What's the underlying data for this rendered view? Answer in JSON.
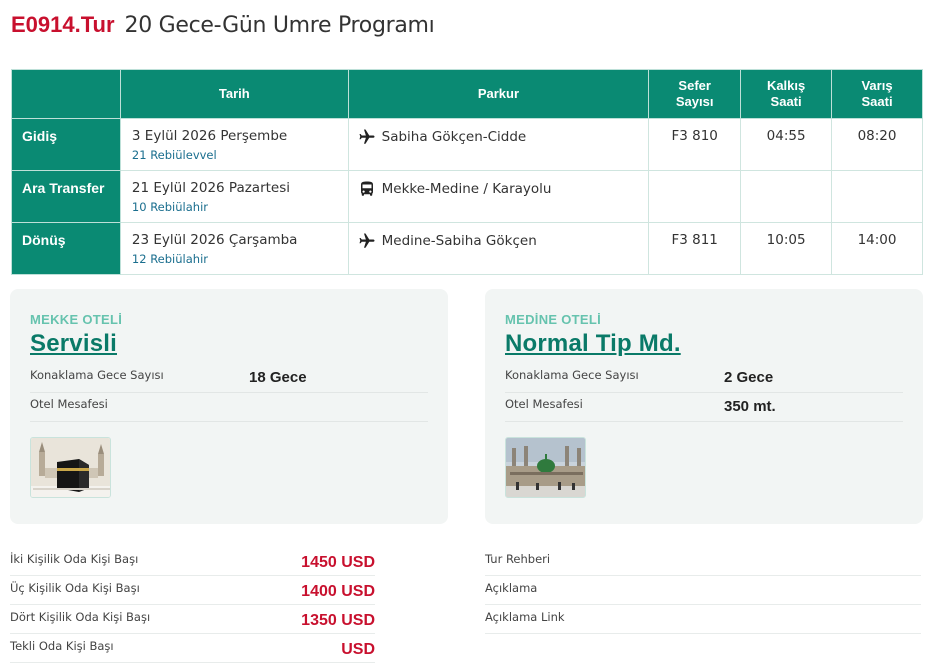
{
  "tour": {
    "code": "E0914.Tur",
    "name": "20 Gece-Gün Umre Programı"
  },
  "itinerary": {
    "headers": {
      "date": "Tarih",
      "route": "Parkur",
      "flight_l1": "Sefer",
      "flight_l2": "Sayısı",
      "dep_l1": "Kalkış",
      "dep_l2": "Saati",
      "arr_l1": "Varış",
      "arr_l2": "Saati"
    },
    "rows": [
      {
        "label": "Gidiş",
        "date": "3 Eylül 2026 Perşembe",
        "hijri": "21 Rebiülevvel",
        "route_icon": "plane-icon",
        "route": "Sabiha Gökçen-Cidde",
        "flight": "F3 810",
        "departure": "04:55",
        "arrival": "08:20"
      },
      {
        "label": "Ara Transfer",
        "date": "21 Eylül 2026 Pazartesi",
        "hijri": "10 Rebiülahir",
        "route_icon": "bus-icon",
        "route": "Mekke-Medine / Karayolu",
        "flight": "",
        "departure": "",
        "arrival": ""
      },
      {
        "label": "Dönüş",
        "date": "23 Eylül 2026 Çarşamba",
        "hijri": "12 Rebiülahir",
        "route_icon": "plane-icon",
        "route": "Medine-Sabiha Gökçen",
        "flight": "F3 811",
        "departure": "10:05",
        "arrival": "14:00"
      }
    ]
  },
  "hotels": {
    "mekke": {
      "label": "MEKKE OTELİ",
      "name": "Servisli",
      "nights_label": "Konaklama Gece Sayısı",
      "nights": "18 Gece",
      "distance_label": "Otel Mesafesi",
      "distance": ""
    },
    "medine": {
      "label": "MEDİNE OTELİ",
      "name": "Normal Tip Md.",
      "nights_label": "Konaklama Gece Sayısı",
      "nights": "2 Gece",
      "distance_label": "Otel Mesafesi",
      "distance": "350 mt."
    }
  },
  "prices": [
    {
      "label": "İki Kişilik Oda Kişi Başı",
      "value": "1450 USD"
    },
    {
      "label": "Üç Kişilik Oda Kişi Başı",
      "value": "1400 USD"
    },
    {
      "label": "Dört Kişilik Oda Kişi Başı",
      "value": "1350 USD"
    },
    {
      "label": "Tekli Oda Kişi Başı",
      "value": "USD"
    }
  ],
  "extras": [
    {
      "label": "Tur Rehberi"
    },
    {
      "label": "Açıklama"
    },
    {
      "label": "Açıklama Link"
    }
  ],
  "colors": {
    "accent": "#0a8a73",
    "price": "#c8102e",
    "hotel_name": "#0a7a68",
    "hotel_label": "#66c3ae",
    "card_bg": "#f2f5f4"
  }
}
